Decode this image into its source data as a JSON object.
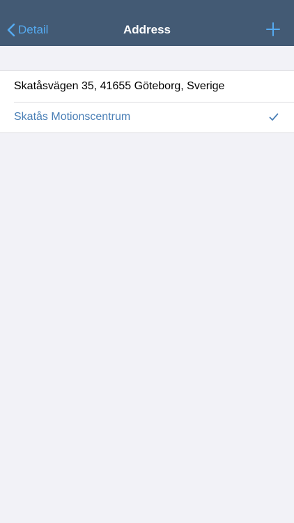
{
  "navbar": {
    "back_label": "Detail",
    "title": "Address",
    "back_icon": "chevron-left-icon",
    "add_icon": "plus-icon",
    "background": "#435a74",
    "accent": "#55aaf0"
  },
  "address_list": {
    "items": [
      {
        "label": "Skatåsvägen 35, 41655 Göteborg, Sverige",
        "selected": false
      },
      {
        "label": "Skatås Motionscentrum",
        "selected": true
      }
    ],
    "selected_color": "#4a7fb6",
    "check_icon": "checkmark-icon"
  }
}
